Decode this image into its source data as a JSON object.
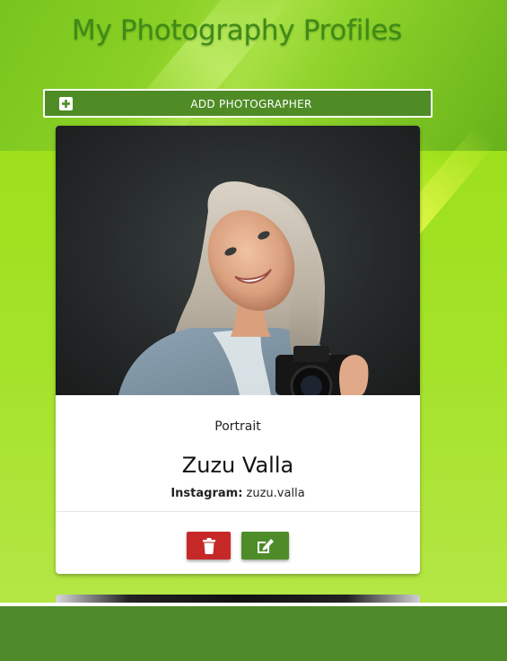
{
  "header": {
    "title": "My Photography Profiles"
  },
  "toolbar": {
    "add_label": "ADD PHOTOGRAPHER"
  },
  "colors": {
    "accent_green": "#4f8c25",
    "delete_red": "#c62828",
    "footer_green": "#4f8a2b"
  },
  "cards": [
    {
      "category": "Portrait",
      "name": "Zuzu Valla",
      "instagram_label": "Instagram:",
      "instagram_handle": "zuzu.valla",
      "actions": {
        "delete_icon": "trash-icon",
        "edit_icon": "edit-icon"
      }
    }
  ]
}
